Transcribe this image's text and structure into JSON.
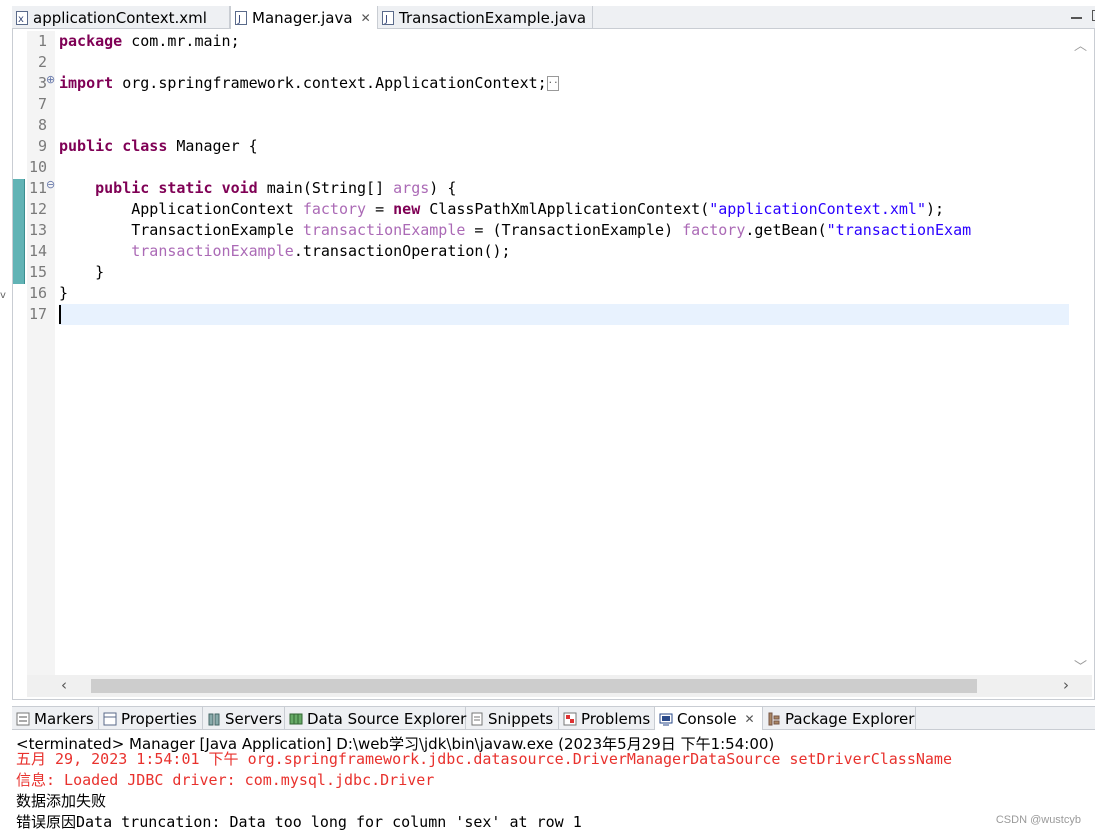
{
  "editor_tabs": [
    {
      "label": "applicationContext.xml",
      "icon": "xml-file-icon",
      "active": false
    },
    {
      "label": "Manager.java",
      "icon": "java-file-icon",
      "active": true
    },
    {
      "label": "TransactionExample.java",
      "icon": "java-file-icon",
      "active": false
    }
  ],
  "editor": {
    "line_numbers": [
      "1",
      "2",
      "3",
      "7",
      "8",
      "9",
      "10",
      "11",
      "12",
      "13",
      "14",
      "15",
      "16",
      "17"
    ],
    "code": {
      "l1_kw": "package",
      "l1_rest": " com.mr.main;",
      "l3_kw": "import",
      "l3_rest": " org.springframework.context.ApplicationContext;",
      "l9_kw1": "public",
      "l9_kw2": "class",
      "l9_rest": " Manager {",
      "l11_indent": "    ",
      "l11_kw1": "public",
      "l11_kw2": "static",
      "l11_kw3": "void",
      "l11_rest1": " main(String[] ",
      "l11_param": "args",
      "l11_rest2": ") {",
      "l12_a": "        ApplicationContext ",
      "l12_var": "factory",
      "l12_b": " = ",
      "l12_kw": "new",
      "l12_c": " ClassPathXmlApplicationContext(",
      "l12_str": "\"applicationContext.xml\"",
      "l12_d": ");",
      "l13_a": "        TransactionExample ",
      "l13_var": "transactionExample",
      "l13_b": " = (TransactionExample) ",
      "l13_var2": "factory",
      "l13_c": ".getBean(",
      "l13_str": "\"transactionExam",
      "l14_a": "        ",
      "l14_var": "transactionExample",
      "l14_b": ".transactionOperation();",
      "l15": "    }",
      "l16": "}"
    }
  },
  "view_tabs": [
    {
      "label": "Markers",
      "icon": "markers-icon",
      "active": false
    },
    {
      "label": "Properties",
      "icon": "properties-icon",
      "active": false
    },
    {
      "label": "Servers",
      "icon": "servers-icon",
      "active": false
    },
    {
      "label": "Data Source Explorer",
      "icon": "data-source-icon",
      "active": false
    },
    {
      "label": "Snippets",
      "icon": "snippets-icon",
      "active": false
    },
    {
      "label": "Problems",
      "icon": "problems-icon",
      "active": false
    },
    {
      "label": "Console",
      "icon": "console-icon",
      "active": true
    },
    {
      "label": "Package Explorer",
      "icon": "package-explorer-icon",
      "active": false
    }
  ],
  "console": {
    "header": "<terminated> Manager [Java Application] D:\\web学习\\jdk\\bin\\javaw.exe (2023年5月29日 下午1:54:00)",
    "lines": [
      "五月 29, 2023 1:54:01 下午 org.springframework.jdbc.datasource.DriverManagerDataSource setDriverClassName",
      "信息: Loaded JDBC driver: com.mysql.jdbc.Driver",
      "数据添加失败",
      "错误原因Data truncation: Data too long for column 'sex' at row 1"
    ],
    "line_colors": [
      "#e8312d",
      "#e8312d",
      "#000000",
      "#000000"
    ]
  },
  "watermark": "CSDN @wustcyb"
}
